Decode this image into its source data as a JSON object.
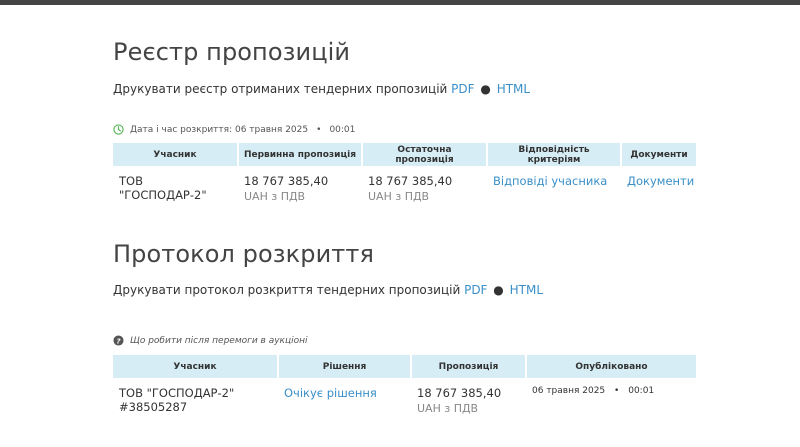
{
  "registry": {
    "title": "Реєстр пропозицій",
    "print_text": "Друкувати реєстр отриманих тендерних пропозицій",
    "pdf_link": "PDF",
    "html_link": "HTML",
    "opening_label": "Дата і час розкриття: 06 травня 2025",
    "opening_time": "00:01",
    "columns": [
      "Учасник",
      "Первинна пропозиція",
      "Остаточна пропозиція",
      "Відповідність критеріям",
      "Документи"
    ],
    "row": {
      "participant": "ТОВ \"ГОСПОДАР-2\"",
      "initial_amount": "18 767 385,40",
      "initial_currency": "UAH з ПДВ",
      "final_amount": "18 767 385,40",
      "final_currency": "UAH з ПДВ",
      "criteria_link": "Відповіді учасника",
      "documents_link": "Документи"
    }
  },
  "protocol": {
    "title": "Протокол розкриття",
    "print_text": "Друкувати протокол розкриття тендерних пропозицій",
    "pdf_link": "PDF",
    "html_link": "HTML",
    "help_text": "Що робити після перемоги в аукціоні",
    "columns": [
      "Учасник",
      "Рішення",
      "Пропозиція",
      "Опубліковано"
    ],
    "row": {
      "participant": "ТОВ \"ГОСПОДАР-2\"",
      "participant_id": "#38505287",
      "decision_link": "Очікує рішення",
      "amount": "18 767 385,40",
      "currency": "UAH з ПДВ",
      "published_date": "06 травня 2025",
      "published_time": "00:01"
    }
  },
  "colors": {
    "link": "#3a8fc8",
    "header_bg": "#d7edf5",
    "clock_icon": "#5cb85c",
    "help_icon": "#555555"
  }
}
